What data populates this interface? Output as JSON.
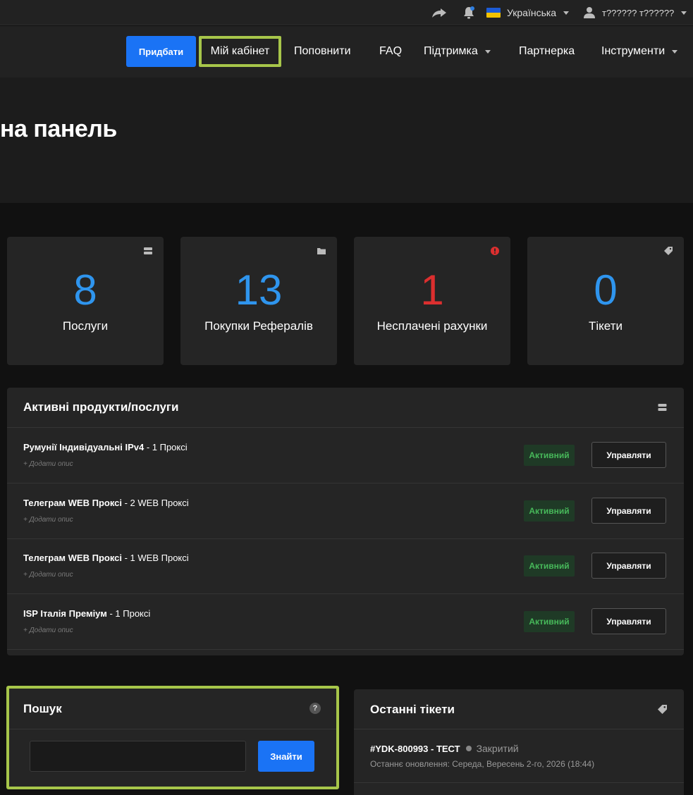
{
  "topbar": {
    "language": "Українська",
    "language_flag_colors": [
      "#1c5bd6",
      "#f2c200"
    ],
    "user_name": "т?????? т??????",
    "notification_dot_color": "#2f7fe0"
  },
  "nav": {
    "buy_label": "Придбати",
    "active_label": "Мій кабінет",
    "topup_label": "Поповнити",
    "faq_label": "FAQ",
    "support_label": "Підтримка",
    "partner_label": "Партнерка",
    "tools_label": "Інструменти"
  },
  "page": {
    "title": "на панель"
  },
  "stats": [
    {
      "value": "8",
      "label": "Послуги",
      "icon": "server-icon",
      "color": "#2f95ee"
    },
    {
      "value": "13",
      "label": "Покупки Рефералів",
      "icon": "folder-icon",
      "color": "#2f95ee"
    },
    {
      "value": "1",
      "label": "Несплачені рахунки",
      "icon": "alert-icon",
      "color": "#dc2f2f"
    },
    {
      "value": "0",
      "label": "Тікети",
      "icon": "tag-icon",
      "color": "#2f95ee"
    }
  ],
  "active_products": {
    "title": "Активні продукти/послуги",
    "items": [
      {
        "name": "Румунії Індивідуальні IPv4",
        "detail": " - 1 Проксі",
        "desc": "+ Додати опис",
        "status": "Активний",
        "action": "Управляти"
      },
      {
        "name": "Телеграм WEB Проксі",
        "detail": " - 2 WEB Проксі",
        "desc": "+ Додати опис",
        "status": "Активний",
        "action": "Управляти"
      },
      {
        "name": "Телеграм WEB Проксі",
        "detail": " - 1 WEB Проксі",
        "desc": "+ Додати опис",
        "status": "Активний",
        "action": "Управляти"
      },
      {
        "name": "ISP Італія Преміум",
        "detail": " - 1 Проксі",
        "desc": "+ Додати опис",
        "status": "Активний",
        "action": "Управляти"
      }
    ]
  },
  "search": {
    "title": "Пошук",
    "help": "?",
    "value": "",
    "button": "Знайти"
  },
  "tickets": {
    "title": "Останні тікети",
    "items": [
      {
        "id": "#YDK-800993 - ТЕСТ",
        "status": "Закритий",
        "updated": "Останнє оновлення: Середа, Вересень 2-го, 2026 (18:44)"
      }
    ]
  }
}
